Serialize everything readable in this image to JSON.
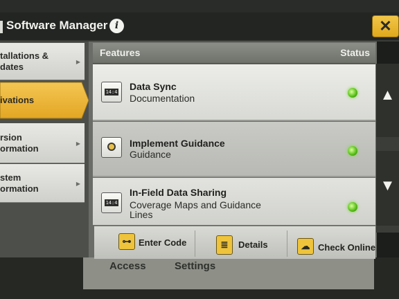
{
  "window": {
    "title": "Software Manager",
    "close_label": "✕"
  },
  "nav": {
    "items": [
      {
        "label": "tallations &\ndates"
      },
      {
        "label": "ivations"
      },
      {
        "label": "rsion\normation"
      },
      {
        "label": "stem\normation"
      }
    ]
  },
  "table": {
    "header_features": "Features",
    "header_status": "Status",
    "rows": [
      {
        "name": "Data Sync",
        "sub": "Documentation",
        "icon": "data-sync-icon",
        "status": "active"
      },
      {
        "name": "Implement Guidance",
        "sub": "Guidance",
        "icon": "guidance-pin-icon",
        "status": "active"
      },
      {
        "name": "In-Field Data Sharing",
        "sub": "Coverage Maps and Guidance\nLines",
        "icon": "data-sharing-icon",
        "status": "active"
      }
    ],
    "icon_display": "14:4"
  },
  "toolbar": {
    "enter_code": "Enter Code",
    "details": "Details",
    "check_online": "Check Online"
  },
  "underlay": {
    "left": "Access",
    "right": "Settings"
  },
  "colors": {
    "accent": "#e7b02c",
    "status_ok": "#5ac21a"
  }
}
